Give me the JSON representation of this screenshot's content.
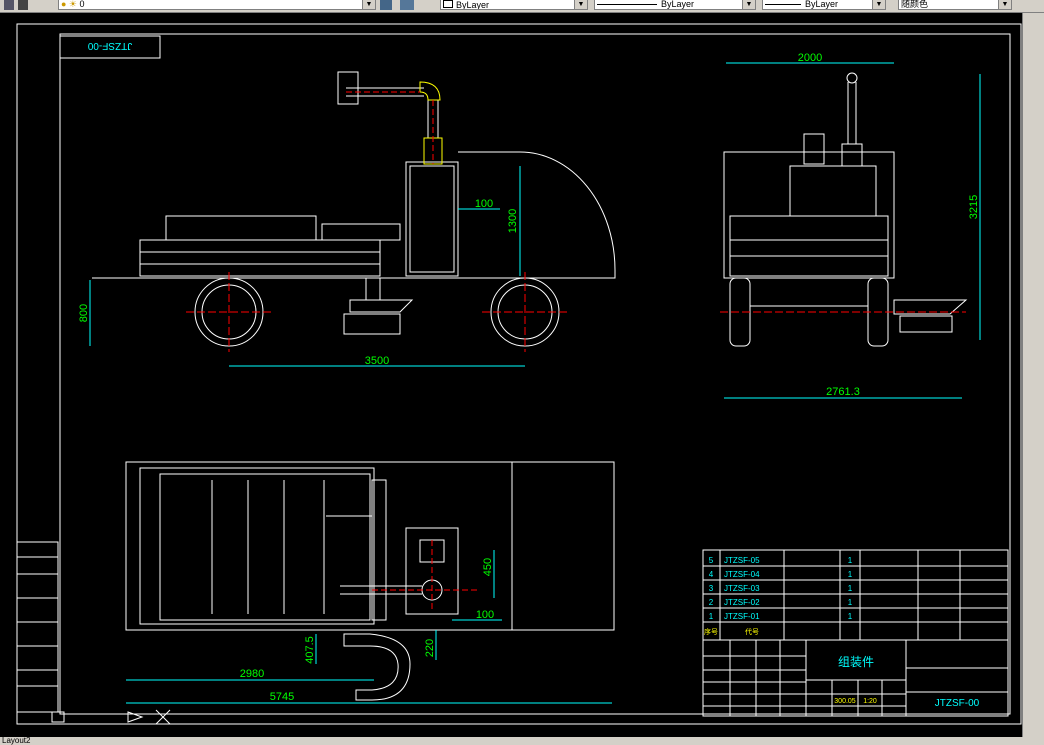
{
  "toolbar": {
    "layer_value": "0",
    "color_combo": "ByLayer",
    "linetype_combo": "ByLayer",
    "lineweight_combo": "ByLayer",
    "plotstyle_combo": "随颜色"
  },
  "drawing": {
    "title_box_text": "JTZSF-00",
    "dims": {
      "front_height_100": "100",
      "front_height_1300": "1300",
      "front_wheel_800": "800",
      "front_wheelbase_3500": "3500",
      "side_width_2000": "2000",
      "side_height_3215": "3215",
      "side_width_2761": "2761.3",
      "top_450": "450",
      "top_100": "100",
      "top_407": "407.5",
      "top_220": "220",
      "top_2980": "2980",
      "top_5745": "5745"
    },
    "bom": {
      "rows": [
        {
          "no": "5",
          "code": "JTZSF-05",
          "qty": "1"
        },
        {
          "no": "4",
          "code": "JTZSF-04",
          "qty": "1"
        },
        {
          "no": "3",
          "code": "JTZSF-03",
          "qty": "1"
        },
        {
          "no": "2",
          "code": "JTZSF-02",
          "qty": "1"
        },
        {
          "no": "1",
          "code": "JTZSF-01",
          "qty": "1"
        }
      ],
      "header": {
        "no": "序号",
        "code": "代号"
      }
    },
    "titleblock": {
      "part_name": "组装件",
      "drawing_no": "JTZSF-00",
      "scale": "1:20",
      "weight": "300.05"
    }
  },
  "status": {
    "layout_tab": "Layout2"
  },
  "colors": {
    "cyan": "#00ffff",
    "white": "#ffffff",
    "red": "#ff0000",
    "green": "#00ff00",
    "yellow": "#ffff00"
  }
}
